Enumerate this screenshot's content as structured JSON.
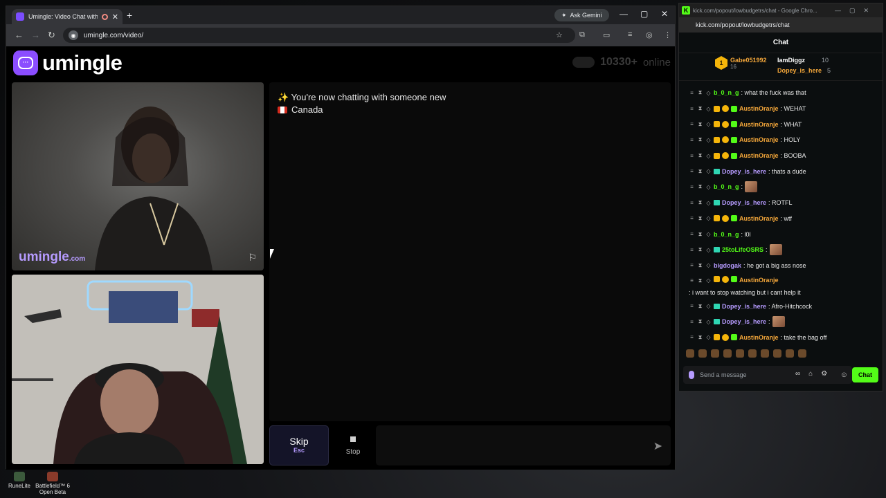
{
  "browser": {
    "tab_title": "Umingle: Video Chat with S",
    "url": "umingle.com/video/",
    "gemini_label": "Ask Gemini"
  },
  "site": {
    "logo_text": "umingle",
    "online_count": "10330+",
    "online_label": "online",
    "watermark": "umingle",
    "watermark_suffix": ".com"
  },
  "chat_pane": {
    "status_line": "✨ You're now chatting with someone new",
    "country": "Canada"
  },
  "controls": {
    "skip_label": "Skip",
    "skip_hint": "Esc",
    "stop_label": "Stop"
  },
  "kick": {
    "window_title": "kick.com/popout/lowbudgetrs/chat - Google Chro...",
    "url": "kick.com/popout/lowbudgetrs/chat",
    "header": "Chat",
    "leaderboard": {
      "first_name": "Gabe051992",
      "first_count": "16",
      "first_rank": "1",
      "second_name": "IamDiggz",
      "second_count": "10",
      "third_name": "Dopey_is_here",
      "third_count": "5"
    },
    "messages": [
      {
        "user": "b_0_n_g",
        "color": "green",
        "text": ": what the fuck was that",
        "badges": "basic"
      },
      {
        "user": "AustinOranje",
        "color": "orange",
        "text": ": WEHAT",
        "badges": "full"
      },
      {
        "user": "AustinOranje",
        "color": "orange",
        "text": ": WHAT",
        "badges": "full"
      },
      {
        "user": "AustinOranje",
        "color": "orange",
        "text": ": HOLY",
        "badges": "full"
      },
      {
        "user": "AustinOranje",
        "color": "orange",
        "text": ": BOOBA",
        "badges": "full"
      },
      {
        "user": "Dopey_is_here",
        "color": "purple",
        "text": ": thats a dude",
        "badges": "gem"
      },
      {
        "user": "b_0_n_g",
        "color": "green",
        "text": ":",
        "badges": "basic",
        "emote": true
      },
      {
        "user": "Dopey_is_here",
        "color": "purple",
        "text": ": ROTFL",
        "badges": "gem"
      },
      {
        "user": "AustinOranje",
        "color": "orange",
        "text": ": wtf",
        "badges": "full"
      },
      {
        "user": "b_0_n_g",
        "color": "green",
        "text": ": l0l",
        "badges": "basic"
      },
      {
        "user": "25toLifeOSRS",
        "color": "green",
        "text": ":",
        "badges": "gem",
        "emote": true
      },
      {
        "user": "bigdogak",
        "color": "purple",
        "text": ": he got a big ass nose",
        "badges": "basic"
      },
      {
        "user": "AustinOranje",
        "color": "orange",
        "text": ": i want to stop watching but i cant help it",
        "badges": "full",
        "tall": true
      },
      {
        "user": "Dopey_is_here",
        "color": "purple",
        "text": ": Afro-Hitchcock",
        "badges": "gem"
      },
      {
        "user": "Dopey_is_here",
        "color": "purple",
        "text": ":",
        "badges": "gem",
        "emote": true
      },
      {
        "user": "AustinOranje",
        "color": "orange",
        "text": ": take the bag off",
        "badges": "full"
      }
    ],
    "input_placeholder": "Send a message",
    "chat_button": "Chat"
  },
  "desktop": {
    "icon1": "RuneLite",
    "icon2_line1": "Battlefield™ 6",
    "icon2_line2": "Open Beta"
  },
  "colors": {
    "brand_purple": "#8b4dff",
    "kick_green": "#53fc18",
    "orange_user": "#f3a63a"
  }
}
